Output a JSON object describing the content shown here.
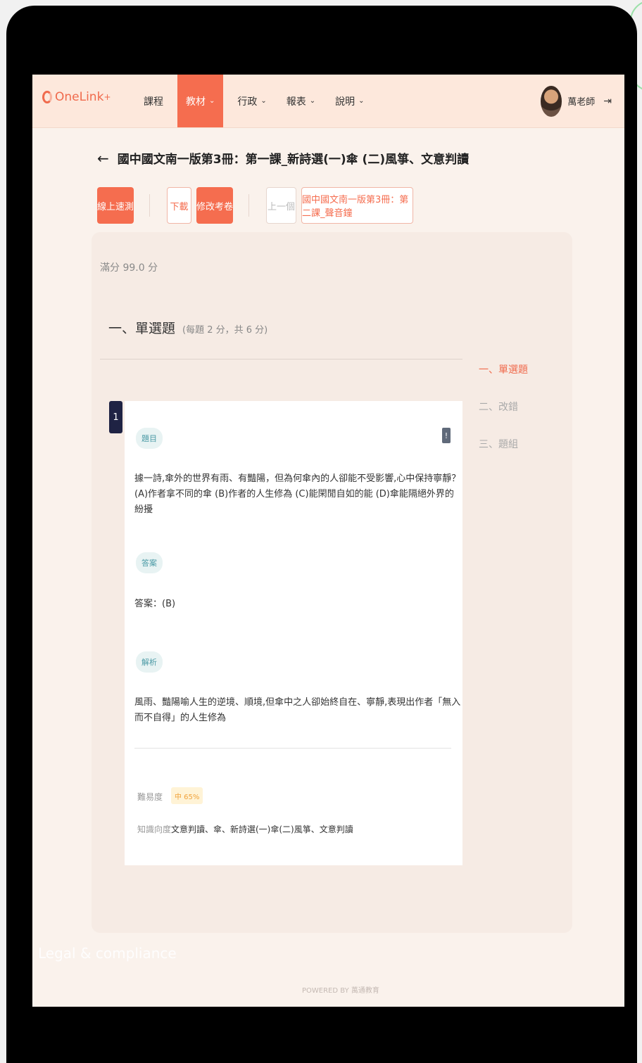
{
  "header": {
    "logo_text": "OneLink",
    "logo_plus": "+",
    "nav": [
      {
        "label": "課程",
        "has_caret": false,
        "active": false
      },
      {
        "label": "教材",
        "has_caret": true,
        "active": true
      },
      {
        "label": "行政",
        "has_caret": true,
        "active": false
      },
      {
        "label": "報表",
        "has_caret": true,
        "active": false
      },
      {
        "label": "說明",
        "has_caret": true,
        "active": false
      }
    ],
    "caret": "⌄",
    "user_name": "萬老師",
    "icons": {
      "back": "arrow-left-icon",
      "logout": "logout-icon",
      "avatar": "avatar-photo"
    }
  },
  "page": {
    "title": "國中國文南一版第3冊：第一課_新詩選(一)傘 (二)風箏、文意判讀",
    "toolbar": {
      "online_test": "線上速測",
      "download": "下載",
      "edit_exam": "修改考卷",
      "prev": "上一個",
      "next_link": "國中國文南一版第3冊：第二課_聲音鐘"
    },
    "full_score": "滿分 99.0 分"
  },
  "section": {
    "title": "一、單選題",
    "note": "(每題 2 分，共 6 分)"
  },
  "toc": {
    "items": [
      "一、單選題",
      "二、改錯",
      "三、題組"
    ],
    "active_index": 0
  },
  "question": {
    "number": "1",
    "tag_question": "題目",
    "text_line1": "據一詩,傘外的世界有雨、有豔陽，但為何傘內的人卻能不受影響,心中保持寧靜？",
    "text_line2": "(A)作者拿不同的傘 (B)作者的人生修為 (C)能閑閒自如的能 (D)傘能隔絕外界的紛擾",
    "tag_answer": "答案",
    "answer": "答案：(B)",
    "tag_analysis": "解析",
    "analysis": "風雨、豔陽喻人生的逆境、順境,但傘中之人卻始終自在、寧靜,表現出作者「無入而不自得」的人生修為",
    "difficulty_label": "難易度",
    "difficulty_value": "中 65%",
    "knowledge_label": "知識向度",
    "knowledge_value": "文意判讀、傘、新詩選(一)傘(二)風箏、文意判讀"
  },
  "footer": {
    "legal": "Legal & compliance",
    "powered": "POWERED BY 萬通教育"
  },
  "colors": {
    "accent": "#f56d4f",
    "header_bg": "#fde8dc",
    "page_bg": "#faf2ec",
    "panel_bg": "#f6ebe4",
    "qnum_bg": "#1f2344",
    "tag_bg": "#e8f3f3",
    "badge_bg": "#fff3d6"
  }
}
